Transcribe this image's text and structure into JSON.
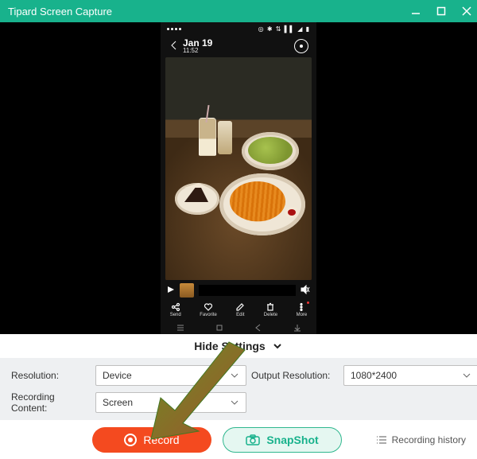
{
  "window": {
    "title": "Tipard Screen Capture"
  },
  "phone": {
    "date": "Jan 19",
    "time": "11:52",
    "actions": {
      "send": "Send",
      "favorite": "Favorite",
      "edit": "Edit",
      "delete": "Delete",
      "more": "More"
    }
  },
  "toggle": {
    "label": "Hide Settings"
  },
  "settings": {
    "resolution_label": "Resolution:",
    "resolution_value": "Device",
    "output_label": "Output Resolution:",
    "output_value": "1080*2400",
    "content_label": "Recording Content:",
    "content_value": "Screen"
  },
  "buttons": {
    "record": "Record",
    "snapshot": "SnapShot",
    "history": "Recording history"
  },
  "colors": {
    "accent": "#18b28c",
    "record": "#f44a1f"
  }
}
